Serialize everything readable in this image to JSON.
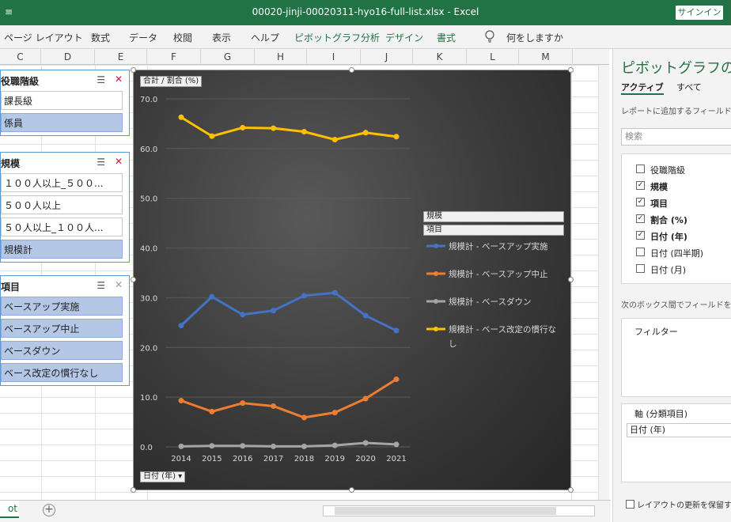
{
  "window": {
    "quick_access": "≡",
    "title": "00020-jinji-00020311-hyo16-full-list.xlsx  -  Excel",
    "signin": "サインイン"
  },
  "ribbon": {
    "tabs": [
      "ページ レイアウト",
      "数式",
      "データ",
      "校閲",
      "表示",
      "ヘルプ",
      "ピボットグラフ分析",
      "デザイン",
      "書式"
    ],
    "tell_me": "何をしますか"
  },
  "columns": [
    "C",
    "D",
    "E",
    "F",
    "G",
    "H",
    "I",
    "J",
    "K",
    "L",
    "M"
  ],
  "slicers": [
    {
      "title": "役職階級",
      "items": [
        {
          "label": "課長級",
          "selected": false
        },
        {
          "label": "係員",
          "selected": true
        }
      ]
    },
    {
      "title": "規模",
      "items": [
        {
          "label": "１００人以上_５００...",
          "selected": false
        },
        {
          "label": "５００人以上",
          "selected": false
        },
        {
          "label": "５０人以上_１００人...",
          "selected": false
        },
        {
          "label": "規模計",
          "selected": true
        }
      ]
    },
    {
      "title": "項目",
      "items": [
        {
          "label": "ベースアップ実施",
          "selected": true
        },
        {
          "label": "ベースアップ中止",
          "selected": true
        },
        {
          "label": "ベースダウン",
          "selected": true
        },
        {
          "label": "ベース改定の慣行なし",
          "selected": true
        }
      ]
    }
  ],
  "chart_buttons": {
    "value_field": "合計 / 割合 (%)",
    "axis_field": "日付 (年) ▾",
    "legend_field1": "規模",
    "legend_field2": "項目"
  },
  "chart_data": {
    "type": "line",
    "x": [
      "2014",
      "2015",
      "2016",
      "2017",
      "2018",
      "2019",
      "2020",
      "2021"
    ],
    "y_ticks": [
      "0.0",
      "10.0",
      "20.0",
      "30.0",
      "40.0",
      "50.0",
      "60.0",
      "70.0"
    ],
    "ylim": [
      0,
      70
    ],
    "grid": true,
    "legend_placement": "right",
    "series": [
      {
        "name": "規模計 - ベースアップ実施",
        "color": "#4472c4",
        "values": [
          24.4,
          30.2,
          26.6,
          27.4,
          30.4,
          31.0,
          26.4,
          23.4
        ]
      },
      {
        "name": "規模計 - ベースアップ中止",
        "color": "#ed7d31",
        "values": [
          9.3,
          7.1,
          8.8,
          8.2,
          5.9,
          6.9,
          9.7,
          13.6
        ]
      },
      {
        "name": "規模計 - ベースダウン",
        "color": "#a5a5a5",
        "values": [
          0.1,
          0.2,
          0.2,
          0.1,
          0.1,
          0.3,
          0.8,
          0.5
        ]
      },
      {
        "name": "規模計 - ベース改定の慣行なし",
        "color": "#ffc000",
        "values": [
          66.3,
          62.5,
          64.2,
          64.1,
          63.4,
          61.8,
          63.2,
          62.4
        ]
      }
    ]
  },
  "pane": {
    "title": "ピボットグラフのフィールド",
    "tab_active": "アクティブ",
    "tab_all": "すべて",
    "hint": "レポートに追加するフィールドを選択してください",
    "search_placeholder": "検索",
    "fields": [
      {
        "label": "役職階級",
        "checked": false
      },
      {
        "label": "規模",
        "checked": true
      },
      {
        "label": "項目",
        "checked": true
      },
      {
        "label": "割合 (%)",
        "checked": true
      },
      {
        "label": "日付 (年)",
        "checked": true
      },
      {
        "label": "日付 (四半期)",
        "checked": false
      },
      {
        "label": "日付 (月)",
        "checked": false
      }
    ],
    "hint2": "次のボックス間でフィールドをドラッグしてください",
    "filter_label": "フィルター",
    "axis_label": "軸 (分類項目)",
    "axis_value": "日付 (年)",
    "defer": "レイアウトの更新を保留する"
  },
  "status": {
    "sheet_tab": "ot"
  }
}
